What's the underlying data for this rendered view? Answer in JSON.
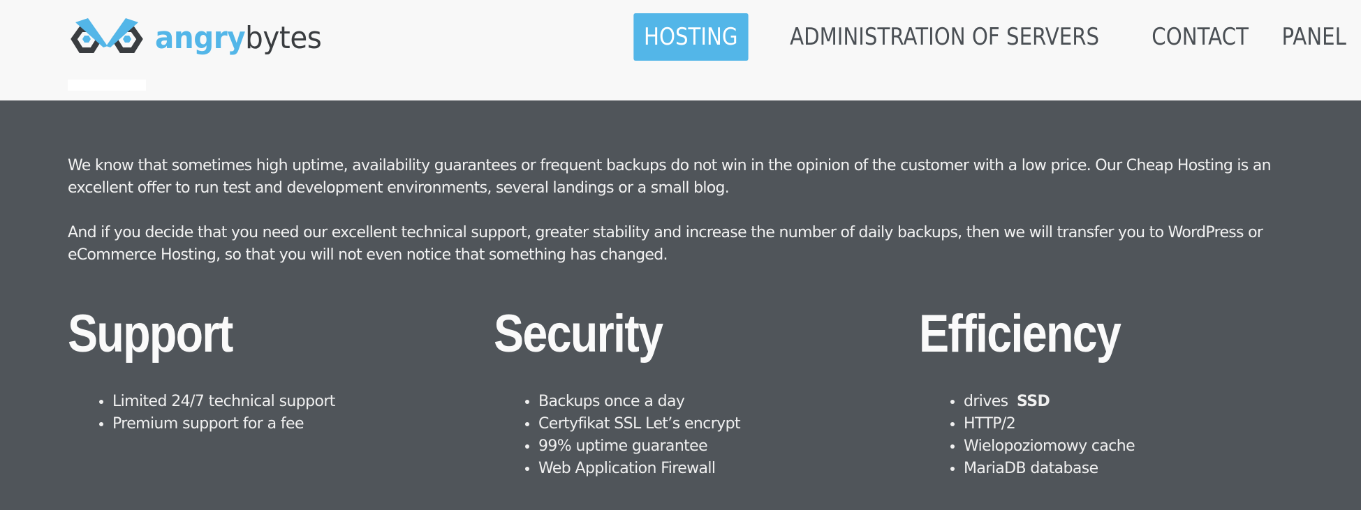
{
  "header": {
    "logo": {
      "text_accent": "angry",
      "text_rest": "bytes",
      "icon": "angry-owl-eyes-logo-icon"
    },
    "nav": [
      {
        "label": "HOSTING",
        "active": true
      },
      {
        "label": "ADMINISTRATION OF SERVERS",
        "active": false
      },
      {
        "label": "CONTACT",
        "active": false
      },
      {
        "label": "PANEL",
        "active": false
      }
    ]
  },
  "intro": {
    "paragraph1": "We know that sometimes high uptime, availability guarantees or frequent backups do not win in the opinion of the customer with a low price. Our Cheap Hosting is an excellent offer to run test and development environments, several landings or a small blog.",
    "paragraph2": "And if you decide that you need our excellent technical support, greater stability and increase the number of daily backups, then we will transfer you to WordPress or eCommerce Hosting, so that you will not even notice that something has changed."
  },
  "features": [
    {
      "title": "Support",
      "items": [
        "Limited 24/7 technical support",
        "Premium support for a fee"
      ]
    },
    {
      "title": "Security",
      "items": [
        "Backups once a day",
        "Certyfikat SSL Let’s encrypt",
        "99% uptime guarantee",
        "Web Application Firewall"
      ]
    },
    {
      "title": "Efficiency",
      "items": [
        "drives",
        "HTTP/2",
        "Wielopoziomowy cache",
        "MariaDB database"
      ],
      "first_item_bold": "SSD"
    }
  ],
  "colors": {
    "accent": "#53b6e8",
    "header_bg": "#f8f8f8",
    "content_bg": "#50555a",
    "logo_dark": "#3a3d40"
  }
}
